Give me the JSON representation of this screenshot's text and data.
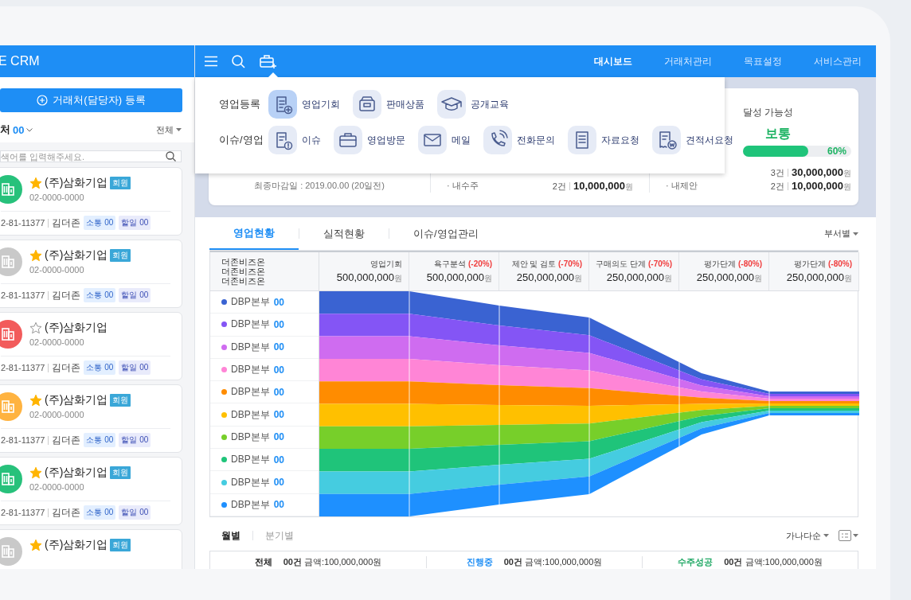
{
  "sidebar": {
    "title": "E CRM",
    "register_button": "거래처(담당자) 등록",
    "count_label": "처",
    "count": "00",
    "filter": "전체",
    "search": {
      "placeholder": "색어를 입력해주세요."
    },
    "clients": [
      {
        "name": "(주)삼화기업",
        "starred": true,
        "badge": "회원",
        "phone": "02-0000-0000",
        "biz_no": "2-81-11377",
        "manager": "김더존",
        "tags": [
          "소통 00",
          "할일 00"
        ],
        "color": "#27c17b"
      },
      {
        "name": "(주)삼화기업",
        "starred": true,
        "badge": "회원",
        "phone": "02-0000-0000",
        "biz_no": "2-81-11377",
        "manager": "김더존",
        "tags": [
          "소통 00",
          "할일 00"
        ],
        "color": "#c9c9c9"
      },
      {
        "name": "(주)삼화기업",
        "starred": false,
        "phone": "02-0000-0000",
        "biz_no": "2-81-11377",
        "manager": "김더존",
        "tags": [
          "소통 00",
          "할일 00"
        ],
        "color": "#f25b5b"
      },
      {
        "name": "(주)삼화기업",
        "starred": true,
        "badge": "회원",
        "phone": "02-0000-0000",
        "biz_no": "2-81-11377",
        "manager": "김더존",
        "tags": [
          "소통 00",
          "할일 00"
        ],
        "color": "#ffb340"
      },
      {
        "name": "(주)삼화기업",
        "starred": true,
        "badge": "회원",
        "phone": "02-0000-0000",
        "biz_no": "2-81-11377",
        "manager": "김더존",
        "tags": [
          "소통 00",
          "할일 00"
        ],
        "color": "#27c17b"
      },
      {
        "name": "(주)삼화기업",
        "starred": true,
        "badge": "회원",
        "color": "#c9c9c9"
      }
    ]
  },
  "topbar": {
    "nav": [
      {
        "label": "대시보드",
        "selected": true
      },
      {
        "label": "거래처관리",
        "selected": false
      },
      {
        "label": "목표설정",
        "selected": false
      },
      {
        "label": "서비스관리",
        "selected": false
      }
    ]
  },
  "menu": {
    "groups": [
      {
        "label": "영업등록",
        "items": [
          {
            "label": "영업기회",
            "kind": "opportunity",
            "selected": true
          },
          {
            "label": "판매상품",
            "kind": "product",
            "selected": false
          },
          {
            "label": "공개교육",
            "kind": "education",
            "selected": false
          }
        ]
      },
      {
        "label": "이슈/영업",
        "items": [
          {
            "label": "이슈",
            "kind": "issue",
            "selected": false
          },
          {
            "label": "영업방문",
            "kind": "visit",
            "selected": false
          },
          {
            "label": "메일",
            "kind": "mail",
            "selected": false
          },
          {
            "label": "전화문의",
            "kind": "call",
            "selected": false
          },
          {
            "label": "자료요청",
            "kind": "data",
            "selected": false
          },
          {
            "label": "견적서요청",
            "kind": "quote",
            "selected": false
          }
        ]
      }
    ]
  },
  "summary": {
    "deadline": "최종마감일 : 2019.00.00 (20일전)",
    "middle_rows": [
      {
        "label": "· 내수주",
        "count": "2건",
        "amount": "10,000,000",
        "unit": "원"
      }
    ],
    "probability": {
      "label": "달성 가능성",
      "value": "보통",
      "level": 0.6,
      "reading": "60%"
    },
    "right_rows": [
      {
        "count": "3건",
        "amount": "30,000,000",
        "unit": "원"
      },
      {
        "label": "· 내제안",
        "count": "2건",
        "amount": "10,000,000",
        "unit": "원"
      }
    ]
  },
  "tabs": [
    {
      "label": "영업현황",
      "selected": true
    },
    {
      "label": "실적현황",
      "selected": false
    },
    {
      "label": "이슈/영업관리",
      "selected": false
    }
  ],
  "group_filter": "부서별",
  "funnel": {
    "header_lines": [
      "더존비즈온",
      "더존비즈온",
      "더존비즈온"
    ],
    "stages": [
      {
        "label": "영업기회",
        "amount": "500,000,000",
        "unit": "원"
      },
      {
        "label": "욕구분석",
        "change": "(-20%)",
        "amount": "500,000,000",
        "unit": "원"
      },
      {
        "label": "제안 및 검토",
        "change": "(-70%)",
        "amount": "250,000,000",
        "unit": "원"
      },
      {
        "label": "구매의도 단계",
        "change": "(-70%)",
        "amount": "250,000,000",
        "unit": "원"
      },
      {
        "label": "평가단계",
        "change": "(-80%)",
        "amount": "250,000,000",
        "unit": "원"
      },
      {
        "label": "평가단계",
        "change": "(-80%)",
        "amount": "250,000,000",
        "unit": "원"
      }
    ],
    "rows": [
      {
        "label": "DBP본부",
        "count": "00",
        "color": "#3a63d2"
      },
      {
        "label": "DBP본부",
        "count": "00",
        "color": "#8455f5"
      },
      {
        "label": "DBP본부",
        "count": "00",
        "color": "#cf6cf0"
      },
      {
        "label": "DBP본부",
        "count": "00",
        "color": "#ff85d6"
      },
      {
        "label": "DBP본부",
        "count": "00",
        "color": "#ff8c00"
      },
      {
        "label": "DBP본부",
        "count": "00",
        "color": "#ffc000"
      },
      {
        "label": "DBP본부",
        "count": "00",
        "color": "#77cf2a"
      },
      {
        "label": "DBP본부",
        "count": "00",
        "color": "#1fc47a"
      },
      {
        "label": "DBP본부",
        "count": "00",
        "color": "#45cce0"
      },
      {
        "label": "DBP본부",
        "count": "00",
        "color": "#1e90ff"
      }
    ]
  },
  "period_tabs": [
    {
      "label": "월별",
      "selected": true
    },
    {
      "label": "분기별",
      "selected": false
    }
  ],
  "sort": "가나다순",
  "totals": [
    {
      "label": "전체",
      "kind": "all",
      "count": "00건",
      "amount": "금액:100,000,000원"
    },
    {
      "label": "진행중",
      "kind": "progress",
      "count": "00건",
      "amount": "금액:100,000,000원"
    },
    {
      "label": "수주성공",
      "kind": "won",
      "count": "00건",
      "amount": "금액:100,000,000원"
    }
  ]
}
